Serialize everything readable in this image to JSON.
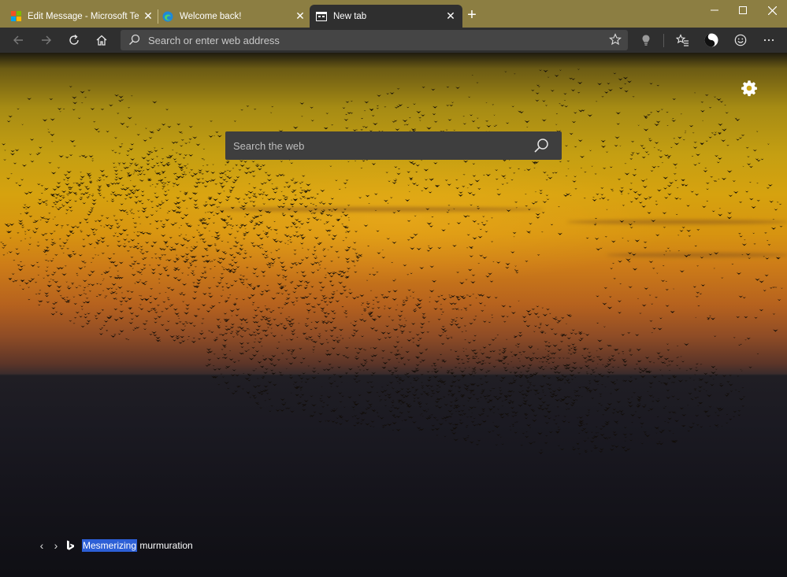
{
  "tabs": [
    {
      "label": "Edit Message - Microsoft Tech C",
      "icon": "microsoft-logo-icon",
      "active": false
    },
    {
      "label": "Welcome back!",
      "icon": "edge-logo-icon",
      "active": false
    },
    {
      "label": "New tab",
      "icon": "newtab-page-icon",
      "active": true
    }
  ],
  "toolbar": {
    "address_placeholder": "Search or enter web address"
  },
  "newtab": {
    "search_placeholder": "Search the web",
    "caption_highlight": "Mesmerizing",
    "caption_rest": " murmuration"
  },
  "colors": {
    "titlebar": "#8c7e42",
    "toolbar": "#2f2f2f",
    "address_bar": "#454545",
    "selection": "#2c5fd6"
  }
}
